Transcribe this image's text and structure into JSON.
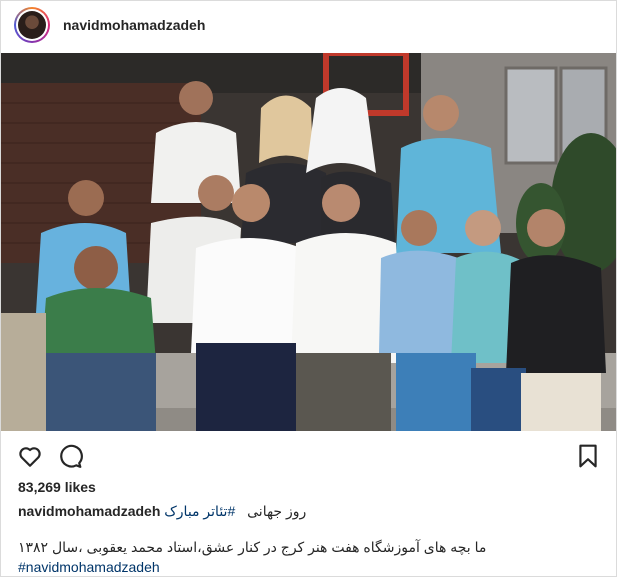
{
  "post": {
    "username": "navidmohamadzadeh",
    "likes": "83,269 likes",
    "caption": {
      "author": "navidmohamadzadeh",
      "line1_hashtag": "#تئاتر مبارک",
      "line1_text": "روز جهانی",
      "line2": "ما بچه های آموزشگاه هفت هنر کرج در کنار عشق،استاد محمد یعقوبی ،سال ۱۳۸۲",
      "line3_hashtag": "#navidmohamadzadeh"
    }
  },
  "icons": {
    "like": "heart-icon",
    "comment": "comment-icon",
    "save": "bookmark-icon"
  },
  "colors": {
    "hashtag": "#003569",
    "text": "#262626",
    "border": "#dbdbdb"
  }
}
